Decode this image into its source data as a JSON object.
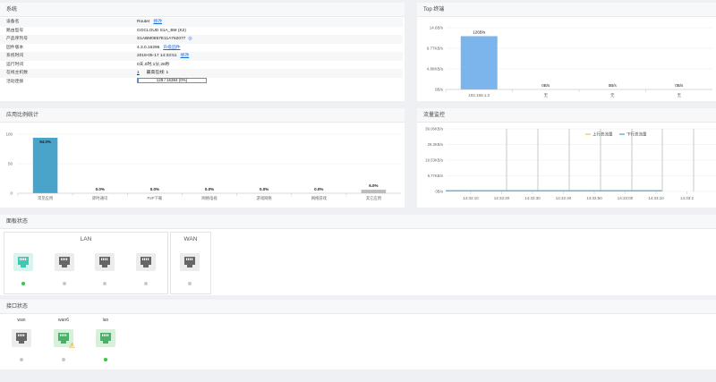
{
  "system": {
    "title": "系统",
    "rows": [
      {
        "k": "设备名",
        "v": "Router",
        "link": "修改"
      },
      {
        "k": "路由型号",
        "v": "GOCLOUD S1A_BM (K2)",
        "link": ""
      },
      {
        "k": "产品序列号",
        "v": "S1ABM0857E11A762077",
        "link": "",
        "icon": true
      },
      {
        "k": "固件版本",
        "v": "4.3.0.16296",
        "link": "升级固件"
      },
      {
        "k": "系统时间",
        "v": "2019-05-17 14:33:51",
        "link": "修改"
      },
      {
        "k": "运行时间",
        "v": "0天,0时,1分,28秒",
        "link": ""
      },
      {
        "k": "在线主机数",
        "v": "1",
        "v2": "最高在线: 1",
        "link": ""
      },
      {
        "k": "活动连接",
        "v": "",
        "link": ""
      }
    ],
    "conn_text": "128 / 16384 (0%)",
    "conn_fraction": 0.01
  },
  "top": {
    "title": "Top 终端",
    "chart_data": {
      "type": "bar",
      "categories": [
        "192.168.1.2",
        "无",
        "无",
        "无"
      ],
      "values": [
        12.6,
        0,
        0,
        0
      ],
      "data_labels": [
        "126B/s",
        "0B/s",
        "0B/s",
        "0B/s"
      ],
      "ytick_labels": [
        "14.6B/s",
        "9.77KB/s",
        "4.88KB/s",
        "0B/s"
      ],
      "ylim": [
        0,
        14.6
      ]
    }
  },
  "app": {
    "title": "应用比例统计",
    "chart_data": {
      "type": "bar",
      "categories": [
        "常见应用",
        "即时通讯",
        "P2P下载",
        "网络电视",
        "游戏网络",
        "网络游戏",
        "其它应用"
      ],
      "values": [
        94,
        0,
        0,
        0,
        0,
        0,
        6
      ],
      "data_labels": [
        "94.0%",
        "0.0%",
        "0.0%",
        "0.0%",
        "0.0%",
        "0.0%",
        "6.0%"
      ],
      "ytick_labels": [
        "100",
        "50",
        "0"
      ],
      "ylim": [
        0,
        100
      ]
    }
  },
  "traffic": {
    "title": "流量监控",
    "legend": [
      "上行总流量",
      "下行总流量"
    ],
    "chart_data": {
      "type": "line",
      "x": [
        "14:32:10",
        "14:32:20",
        "14:32:30",
        "14:32:40",
        "14:32:50",
        "14:33:00",
        "14:33:10",
        "14:33:2"
      ],
      "ytick_labels": [
        "39.06KB/s",
        "29.3KB/s",
        "19.53KB/s",
        "9.77KB/s",
        "0B/s"
      ],
      "series": [
        {
          "name": "上行总流量",
          "values": [
            0,
            0,
            0,
            0,
            0,
            0,
            0,
            0
          ]
        },
        {
          "name": "下行总流量",
          "values": [
            0,
            0,
            0,
            0,
            0,
            0,
            0,
            0
          ]
        }
      ]
    }
  },
  "panel_state": {
    "title": "面板状态",
    "lan_label": "LAN",
    "wan_label": "WAN",
    "lan_ports": [
      {
        "on": true,
        "active": true
      },
      {
        "on": false
      },
      {
        "on": false
      },
      {
        "on": false
      }
    ],
    "wan_ports": [
      {
        "on": false
      }
    ]
  },
  "iface_state": {
    "title": "接口状态",
    "ifaces": [
      {
        "label": "wan",
        "on": false,
        "warn": false,
        "active": false
      },
      {
        "label": "wan6",
        "on": false,
        "warn": true,
        "active": true
      },
      {
        "label": "lan",
        "on": true,
        "warn": false,
        "active": true
      }
    ]
  },
  "colors": {
    "accent": "#4aa3c8",
    "bar": "#7cb5ec",
    "link": "#1a6bd6",
    "online": "#2ecc40"
  }
}
